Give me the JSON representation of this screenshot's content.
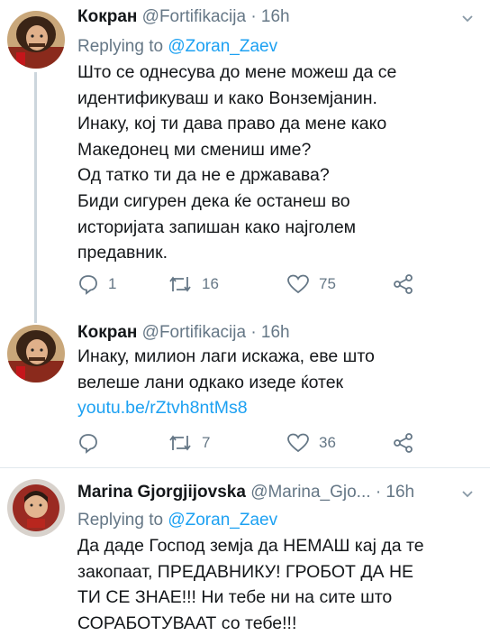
{
  "tweets": [
    {
      "name": "Кокран",
      "handle": "@Fortifikacija",
      "dot": "·",
      "time": "16h",
      "reply_prefix": "Replying to",
      "reply_mention": "@Zoran_Zaev",
      "lines": [
        "Што се однесува до мене можеш да се",
        "идентификуваш и како Вонземјанин.",
        "Инаку, кој ти дава право да мене како",
        "Македонец ми смениш име?",
        "Од татко ти да не е државава?",
        "Биди сигурен дека ќе останеш во",
        "историјата запишан како најголем",
        "предавник."
      ],
      "replies": "1",
      "retweets": "16",
      "likes": "75"
    },
    {
      "name": "Кокран",
      "handle": "@Fortifikacija",
      "dot": "·",
      "time": "16h",
      "lines": [
        "Инаку, милион лаги искажа, еве што",
        "велеше лани одкако изеде ќотек"
      ],
      "link": "youtu.be/rZtvh8ntMs8",
      "replies": "",
      "retweets": "7",
      "likes": "36"
    },
    {
      "name": "Marina Gjorgjijovska",
      "handle": "@Marina_Gjo...",
      "dot": "·",
      "time": "16h",
      "reply_prefix": "Replying to",
      "reply_mention": "@Zoran_Zaev",
      "lines": [
        "Да даде Господ земја да НЕМАШ кај да те",
        "закопаат, ПРЕДАВНИКУ! ГРОБОТ ДА НЕ",
        "ТИ СЕ ЗНАЕ!!! Ни тебе ни на сите што",
        "СОРАБОТУВААТ со тебе!!!"
      ]
    }
  ],
  "colors": {
    "text": "#14171a",
    "secondary": "#657786",
    "link": "#1da1f2",
    "divider": "#e1e8ed"
  }
}
